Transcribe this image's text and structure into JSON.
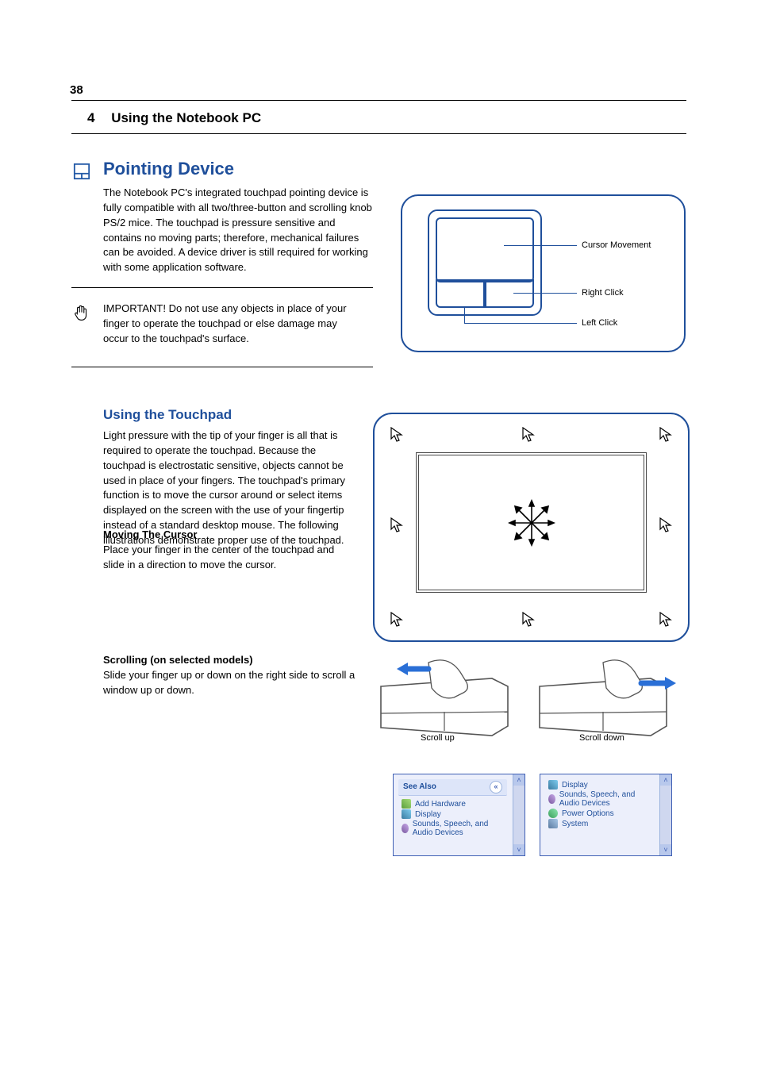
{
  "page_number": "38",
  "section_header": {
    "number": "4",
    "title": "Using the Notebook PC"
  },
  "heading1": "Pointing Device",
  "para_intro": "The Notebook PC's integrated touchpad pointing device is fully compatible with all two/three-button and scrolling knob PS/2 mice. The touchpad is pressure sensitive and contains no moving parts; therefore, mechanical failures can be avoided. A device driver is still required for working with some application software.",
  "important_note": "IMPORTANT! Do not use any objects in place of your finger to operate the touchpad or else damage may occur to the touchpad's surface.",
  "heading2": "Using the Touchpad",
  "para_use1": "Light pressure with the tip of your finger is all that is required to operate the touchpad. Because the touchpad is electrostatic sensitive, objects cannot be used in place of your fingers. The touchpad's primary function is to move the cursor around or select items displayed on the screen with the use of your fingertip instead of a standard desktop mouse. The following illustrations demonstrate proper use of the touchpad.",
  "moving_cursor_heading": "Moving The Cursor",
  "para_move": "Place your finger in the center of the touchpad and slide in a direction to move the cursor.",
  "scrolling_heading": "Scrolling (on selected models)",
  "para_scroll": "Slide your finger up or down on the right side to scroll a window up or down.",
  "scroll_caption_left": "Scroll up",
  "scroll_caption_right": "Scroll down",
  "touchpad_labels": {
    "cursor_area": "Cursor Movement",
    "right_click": "Right Click",
    "left_click": "Left Click"
  },
  "control_panel": {
    "left": {
      "header": "See Also",
      "items": [
        "Add Hardware",
        "Display",
        "Sounds, Speech, and Audio Devices"
      ]
    },
    "right": {
      "items": [
        "Display",
        "Sounds, Speech, and Audio Devices",
        "Power Options",
        "System"
      ]
    }
  }
}
